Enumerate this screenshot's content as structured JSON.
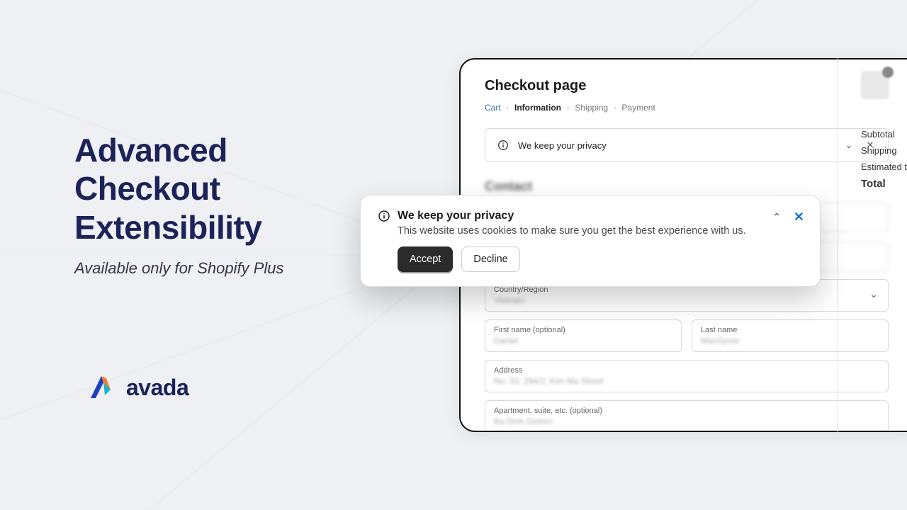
{
  "hero": {
    "title": "Advanced Checkout Extensibility",
    "subtitle": "Available only for Shopify Plus"
  },
  "brand": {
    "name": "avada"
  },
  "checkout": {
    "title": "Checkout page",
    "breadcrumbs": [
      {
        "label": "Cart",
        "state": "link"
      },
      {
        "label": "Information",
        "state": "active"
      },
      {
        "label": "Shipping",
        "state": "dim"
      },
      {
        "label": "Payment",
        "state": "dim"
      }
    ],
    "privacy_bar": "We keep your privacy",
    "contact_heading": "Contact",
    "fields": {
      "country_label": "Country/Region",
      "country_value": "Vietnam",
      "first_name_label": "First name (optional)",
      "first_name_value": "Daniel",
      "last_name_label": "Last name",
      "last_name_value": "MacGyver",
      "address_label": "Address",
      "address_value": "No. 33, 294/2, Kim Ma Street",
      "apt_label": "Apartment, suite, etc. (optional)",
      "apt_value": "Ba Dinh District"
    }
  },
  "summary": {
    "subtotal_label": "Subtotal",
    "shipping_label": "Shipping",
    "tax_label": "Estimated tax",
    "total_label": "Total"
  },
  "cookie": {
    "title": "We keep your privacy",
    "body": "This website uses cookies to make sure you get the best experience with us.",
    "accept": "Accept",
    "decline": "Decline"
  }
}
